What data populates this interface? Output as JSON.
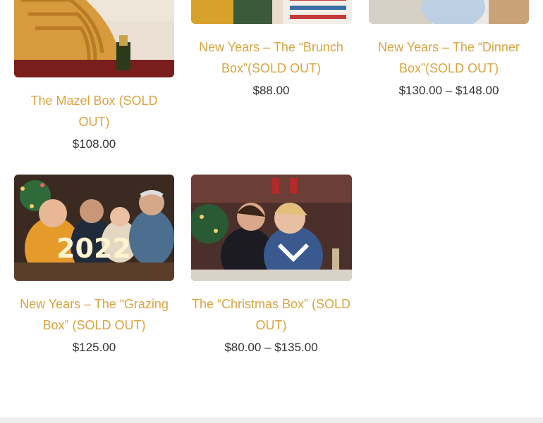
{
  "colors": {
    "link": "#d9a441",
    "price": "#333333"
  },
  "products": [
    {
      "title": "The Mazel Box (SOLD OUT)",
      "price": "$108.00",
      "image": "mazel-box-photo"
    },
    {
      "title": "New Years – The “Brunch Box”(SOLD OUT)",
      "price": "$88.00",
      "image": "brunch-box-photo"
    },
    {
      "title": "New Years – The “Dinner Box”(SOLD OUT)",
      "price": "$130.00 – $148.00",
      "image": "dinner-box-photo"
    },
    {
      "title": "New Years – The “Grazing Box” (SOLD OUT)",
      "price": "$125.00",
      "image": "grazing-box-photo",
      "image_text": "2022"
    },
    {
      "title": "The “Christmas Box” (SOLD OUT)",
      "price": "$80.00 – $135.00",
      "image": "christmas-box-photo"
    }
  ]
}
